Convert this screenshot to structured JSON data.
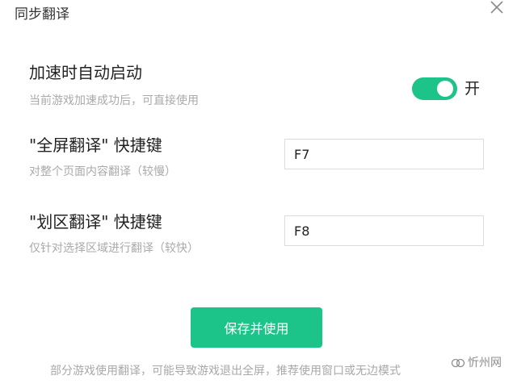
{
  "dialog": {
    "title": "同步翻译",
    "close_icon": "close-icon"
  },
  "auto_start": {
    "title": "加速时自动启动",
    "subtitle": "当前游戏加速成功后，可直接使用",
    "toggle_on": true,
    "toggle_label": "开"
  },
  "fullscreen_translate": {
    "title": "\"全屏翻译\" 快捷键",
    "subtitle": "对整个页面内容翻译（较慢）",
    "hotkey": "F7"
  },
  "region_translate": {
    "title": "\"划区翻译\" 快捷键",
    "subtitle": "仅针对选择区域进行翻译（较快）",
    "hotkey": "F8"
  },
  "save_label": "保存并使用",
  "footnote": "部分游戏使用翻译，可能导致游戏退出全屏，推荐使用窗口或无边模式",
  "watermark": "忻州网",
  "colors": {
    "accent": "#1cc48a",
    "muted_text": "#aaaaaa"
  }
}
